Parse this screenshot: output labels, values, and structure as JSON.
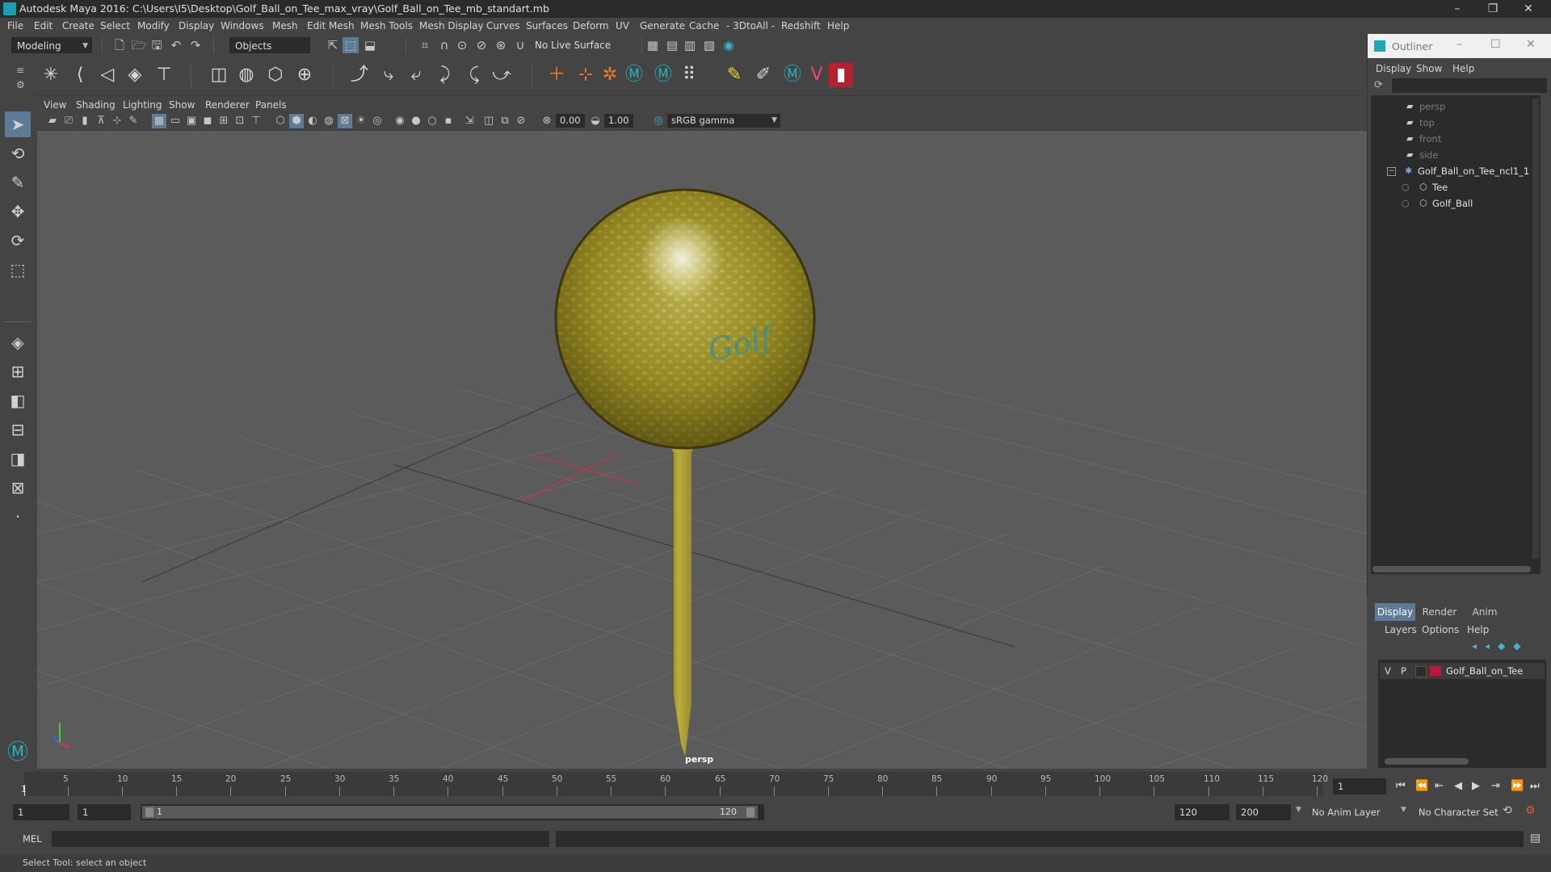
{
  "window": {
    "title": "Autodesk Maya 2016: C:\\Users\\I5\\Desktop\\Golf_Ball_on_Tee_max_vray\\Golf_Ball_on_Tee_mb_standart.mb",
    "minimize": "–",
    "restore": "❐",
    "close": "✕"
  },
  "menubar": [
    "File",
    "Edit",
    "Create",
    "Select",
    "Modify",
    "Display",
    "Windows",
    "Mesh",
    "Edit Mesh",
    "Mesh Tools",
    "Mesh Display",
    "Curves",
    "Surfaces",
    "Deform",
    "UV",
    "Generate",
    "Cache",
    "- 3DtoAll -",
    "Redshift",
    "Help"
  ],
  "statusline": {
    "mode": "Modeling",
    "selection_mode": "Objects",
    "live_surface": "No Live Surface"
  },
  "viewport": {
    "menu": [
      "View",
      "Shading",
      "Lighting",
      "Show",
      "Renderer",
      "Panels"
    ],
    "exposure": "0.00",
    "gamma": "1.00",
    "colorspace": "sRGB gamma",
    "camera_label": "persp",
    "logo_text": "Golf"
  },
  "outliner": {
    "title": "Outliner",
    "menu": [
      "Display",
      "Show",
      "Help"
    ],
    "items": [
      {
        "label": "persp",
        "kind": "camera"
      },
      {
        "label": "top",
        "kind": "camera"
      },
      {
        "label": "front",
        "kind": "camera"
      },
      {
        "label": "side",
        "kind": "camera"
      },
      {
        "label": "Golf_Ball_on_Tee_ncl1_1",
        "kind": "group"
      },
      {
        "label": "Tee",
        "kind": "mesh"
      },
      {
        "label": "Golf_Ball",
        "kind": "mesh"
      }
    ]
  },
  "layer_editor": {
    "tabs": [
      "Display",
      "Render",
      "Anim"
    ],
    "menu": [
      "Layers",
      "Options",
      "Help"
    ],
    "layer": {
      "v": "V",
      "p": "P",
      "name": "Golf_Ball_on_Tee",
      "color": "#c0143c"
    }
  },
  "timeline": {
    "ticks": [
      "5",
      "10",
      "15",
      "20",
      "25",
      "30",
      "35",
      "40",
      "45",
      "50",
      "55",
      "60",
      "65",
      "70",
      "75",
      "80",
      "85",
      "90",
      "95",
      "100",
      "105",
      "110",
      "115",
      "120"
    ],
    "first_tick": "1",
    "current_frame": "1"
  },
  "range": {
    "start": "1",
    "playback_start": "1",
    "range_start_label": "1",
    "range_end_label": "120",
    "playback_end": "120",
    "end": "200",
    "anim_layer": "No Anim Layer",
    "character_set": "No Character Set"
  },
  "cmdline": {
    "lang": "MEL"
  },
  "helpline": {
    "text": "Select Tool: select an object"
  },
  "colors": {
    "ball": "#b5a832",
    "accent": "#5d7a97",
    "panel": "#444444",
    "field": "#2b2b2b"
  }
}
